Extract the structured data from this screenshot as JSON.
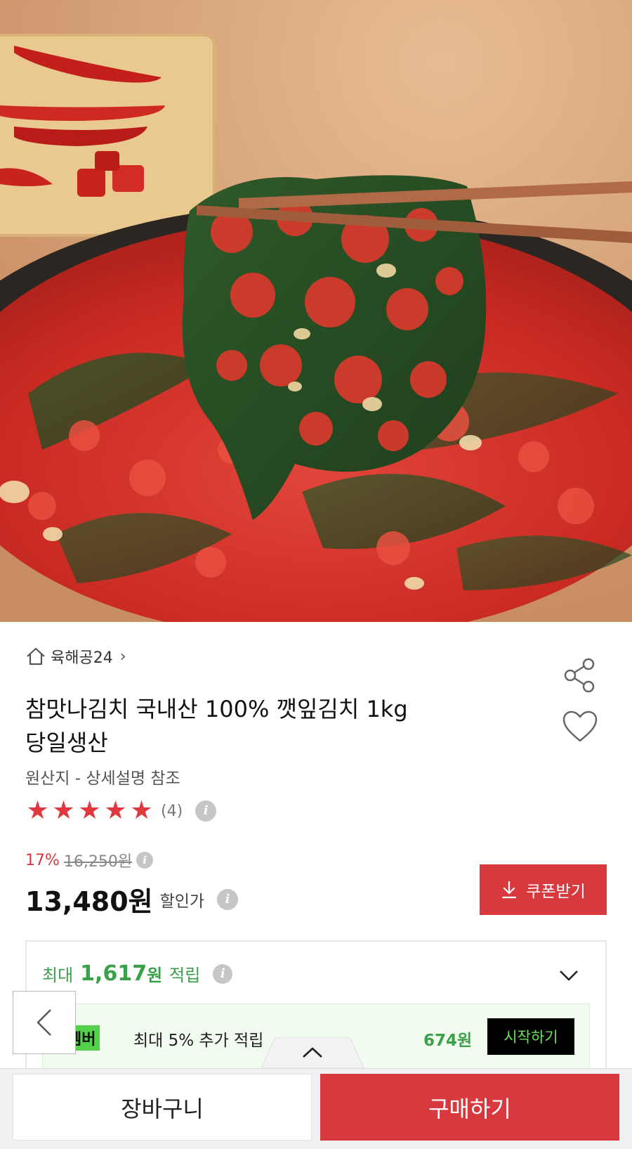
{
  "product": {
    "store_name": "육해공24",
    "title_line1": "참맛나김치 국내산 100% 깻잎김치 1kg",
    "title_line2": "당일생산",
    "origin": "원산지 - 상세설명 참조",
    "rating_stars": 5,
    "review_count": "(4)",
    "discount_percent": "17%",
    "original_price": "16,250원",
    "sale_price": "13,480원",
    "sale_price_label": "할인가",
    "coupon_button": "쿠폰받기"
  },
  "reward": {
    "prefix": "최대",
    "amount": "1,617",
    "unit": "원",
    "suffix": "적립"
  },
  "membership": {
    "badge": "멤버",
    "text": "최대 5% 추가 적립",
    "amount": "674원",
    "start_button": "시작하기"
  },
  "bottom_bar": {
    "cart_button": "장바구니",
    "buy_button": "구매하기"
  },
  "colors": {
    "accent_red": "#d8393e",
    "reward_green": "#3aa04a",
    "member_green": "#55d04a"
  },
  "icons": [
    "home-icon",
    "chevron-right-icon",
    "share-icon",
    "heart-icon",
    "star-icon",
    "info-icon",
    "download-icon",
    "chevron-down-icon",
    "chevron-left-icon",
    "chevron-up-icon"
  ]
}
